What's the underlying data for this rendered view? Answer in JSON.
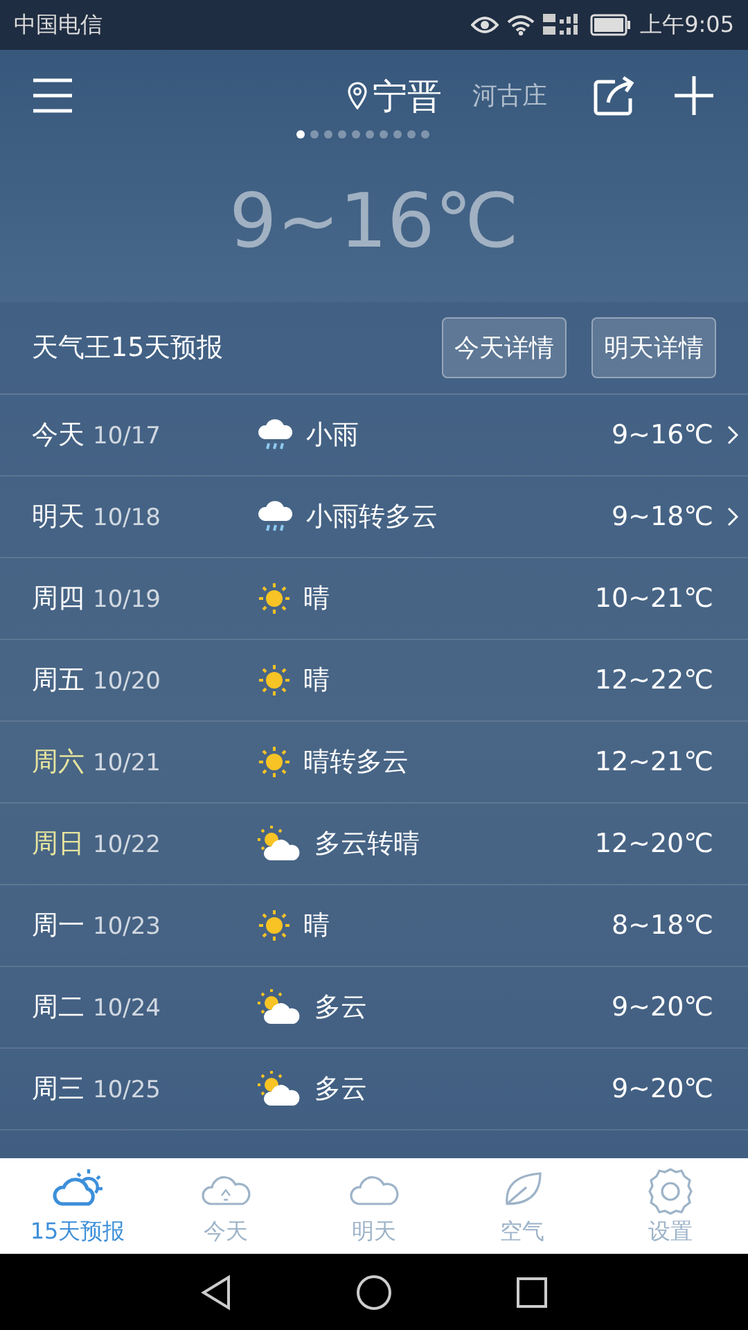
{
  "status_bar": {
    "carrier": "中国电信",
    "time": "上午9:05"
  },
  "header": {
    "city": "宁晋",
    "next_city": "河古庄",
    "pages": [
      {
        "selected": true
      },
      {
        "selected": false
      },
      {
        "selected": false
      },
      {
        "selected": false
      },
      {
        "selected": false
      },
      {
        "selected": false
      },
      {
        "selected": false
      },
      {
        "selected": false
      },
      {
        "selected": false
      },
      {
        "selected": false
      }
    ]
  },
  "current": {
    "temperature": "9~16℃"
  },
  "forecast": {
    "title": "天气王15天预报",
    "buttons": [
      "今天详情",
      "明天详情"
    ],
    "days": [
      {
        "day": "今天",
        "date": "10/17",
        "kind": "rain",
        "weather": "小雨",
        "temp": "9~16℃",
        "weekend": false,
        "has_detail": true
      },
      {
        "day": "明天",
        "date": "10/18",
        "kind": "rain",
        "weather": "小雨转多云",
        "temp": "9~18℃",
        "weekend": false,
        "has_detail": true
      },
      {
        "day": "周四",
        "date": "10/19",
        "kind": "sun",
        "weather": "晴",
        "temp": "10~21℃",
        "weekend": false,
        "has_detail": false
      },
      {
        "day": "周五",
        "date": "10/20",
        "kind": "sun",
        "weather": "晴",
        "temp": "12~22℃",
        "weekend": false,
        "has_detail": false
      },
      {
        "day": "周六",
        "date": "10/21",
        "kind": "sun",
        "weather": "晴转多云",
        "temp": "12~21℃",
        "weekend": true,
        "has_detail": false
      },
      {
        "day": "周日",
        "date": "10/22",
        "kind": "partly",
        "weather": "多云转晴",
        "temp": "12~20℃",
        "weekend": true,
        "has_detail": false
      },
      {
        "day": "周一",
        "date": "10/23",
        "kind": "sun",
        "weather": "晴",
        "temp": "8~18℃",
        "weekend": false,
        "has_detail": false
      },
      {
        "day": "周二",
        "date": "10/24",
        "kind": "partly",
        "weather": "多云",
        "temp": "9~20℃",
        "weekend": false,
        "has_detail": false
      },
      {
        "day": "周三",
        "date": "10/25",
        "kind": "partly",
        "weather": "多云",
        "temp": "9~20℃",
        "weekend": false,
        "has_detail": false
      }
    ]
  },
  "tabs": [
    {
      "label": "15天预报",
      "kind": "forecast",
      "selected": true
    },
    {
      "label": "今天",
      "kind": "today",
      "selected": false
    },
    {
      "label": "明天",
      "kind": "tomorrow",
      "selected": false
    },
    {
      "label": "空气",
      "kind": "air",
      "selected": false
    },
    {
      "label": "设置",
      "kind": "settings",
      "selected": false
    }
  ]
}
